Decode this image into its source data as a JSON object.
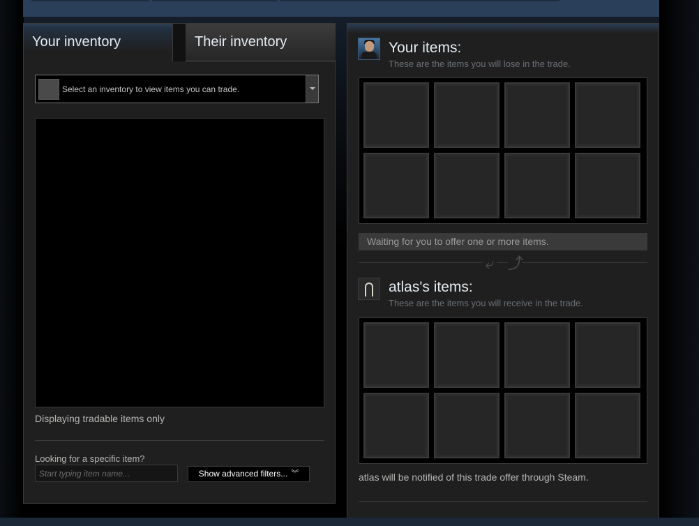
{
  "tabs": {
    "your_inventory": "Your inventory",
    "their_inventory": "Their inventory"
  },
  "inventory_select": {
    "placeholder": "Select an inventory to view items you can trade."
  },
  "inventory_note": "Displaying tradable items only",
  "search": {
    "label": "Looking for a specific item?",
    "placeholder": "Start typing item name...",
    "value": ""
  },
  "advanced_filters": {
    "label": "Show advanced filters...",
    "icon": "double-chevron-down-icon"
  },
  "your_items": {
    "title": "Your items:",
    "subtitle": "These are the items you will lose in the trade.",
    "slots": 8
  },
  "status": {
    "waiting": "Waiting for you to offer one or more items."
  },
  "swap_icons": [
    "arrow-down-left-icon",
    "arrow-up-right-icon"
  ],
  "their_items": {
    "title": "atlas's items:",
    "subtitle": "These are the items you will receive in the trade.",
    "slots": 8
  },
  "notify_text": "atlas will be notified of this trade offer through Steam.",
  "colors": {
    "panel_bg": "#1f1f1f",
    "accent_blue": "#2a3f5a",
    "slot_bg": "#262626",
    "text_primary": "#e4ebf1",
    "text_muted": "#6a6f75"
  }
}
